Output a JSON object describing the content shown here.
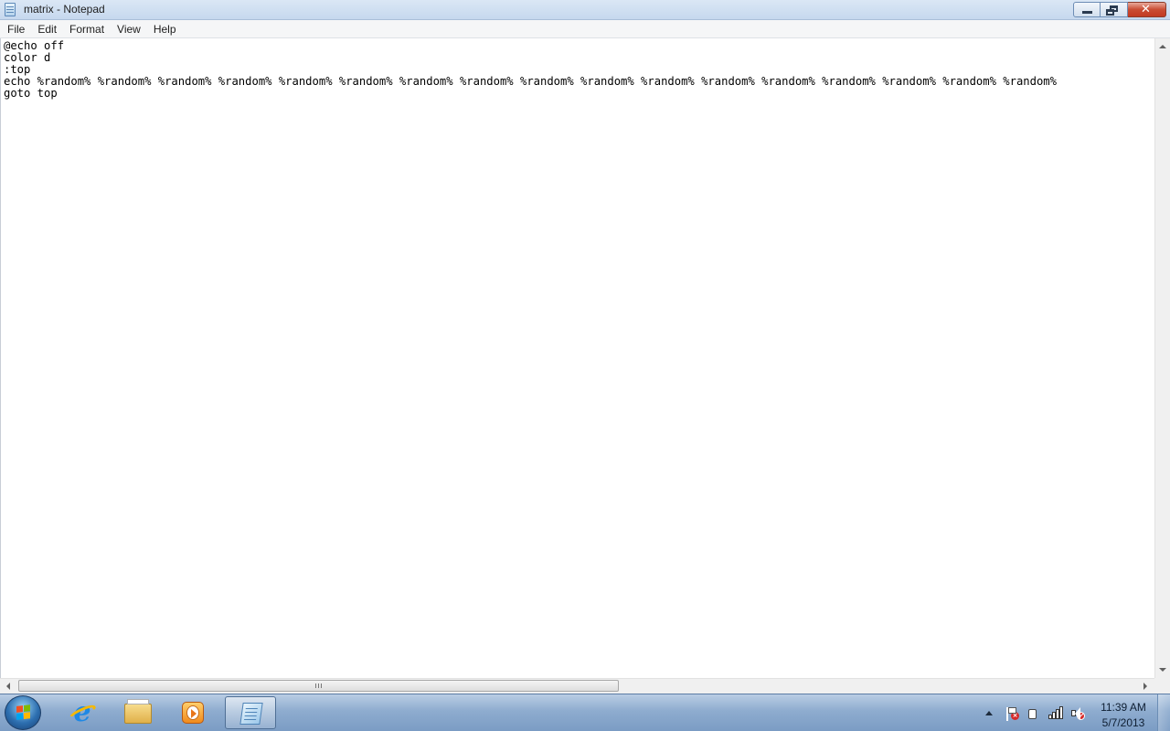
{
  "window": {
    "title": "matrix - Notepad"
  },
  "menu": {
    "items": [
      "File",
      "Edit",
      "Format",
      "View",
      "Help"
    ]
  },
  "editor": {
    "lines": [
      "@echo off",
      "color d",
      ":top",
      "echo %random% %random% %random% %random% %random% %random% %random% %random% %random% %random% %random% %random% %random% %random% %random% %random% %random%",
      "goto top"
    ]
  },
  "taskbar": {
    "pinned": [
      {
        "icon": "internet-explorer-icon"
      },
      {
        "icon": "windows-explorer-icon"
      },
      {
        "icon": "media-player-icon"
      },
      {
        "icon": "notepad-icon",
        "active": true
      }
    ],
    "clock": {
      "time": "11:39 AM",
      "date": "5/7/2013"
    },
    "tray_icons": [
      "action-center-flag-icon",
      "power-icon",
      "network-signal-icon",
      "volume-muted-icon"
    ]
  },
  "colors": {
    "titlebar": "#c6d8ee",
    "close_button": "#c94c33",
    "taskbar": "#8eaccf",
    "editor_background": "#ffffff"
  }
}
